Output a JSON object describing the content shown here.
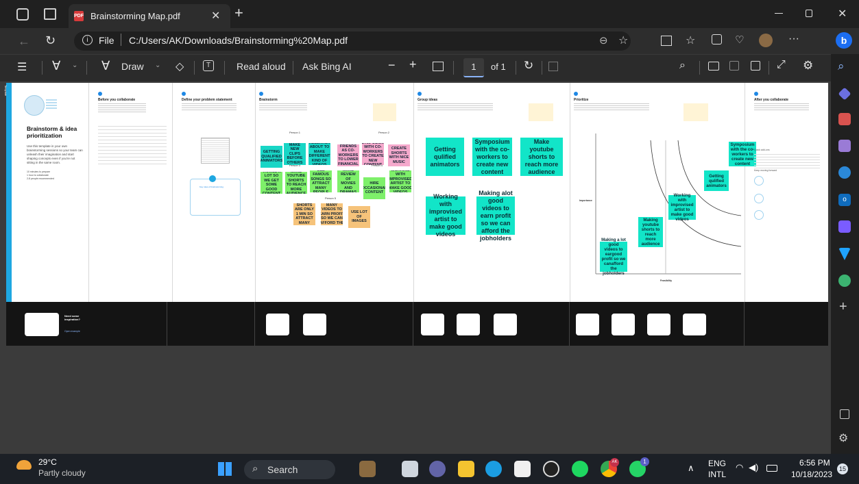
{
  "browser": {
    "tab_title": "Brainstorming Map.pdf",
    "pdf_badge": "PDF",
    "address_prefix": "File",
    "url": "C:/Users/AK/Downloads/Brainstorming%20Map.pdf"
  },
  "toolbar": {
    "draw_label": "Draw",
    "read_aloud_label": "Read aloud",
    "ask_bing_label": "Ask Bing AI",
    "page_current": "1",
    "page_total_label": "of 1"
  },
  "document": {
    "template_tab": "Template",
    "frame1": {
      "title": "Brainstorm & idea prioritization",
      "body": "Use this template in your own brainstorming sessions so your team can unleash their imagination and start shaping concepts even if you're not sitting in the same room.",
      "meta": [
        "10 minutes to prepare",
        "1 hour to collaborate",
        "2-8 people recommended"
      ]
    },
    "frame2": {
      "title": "Before you collaborate"
    },
    "frame3": {
      "title": "Define your problem statement",
      "ring_title": "Key rules of brainstorming"
    },
    "frame4": {
      "title": "Brainstorm",
      "person_labels": [
        "Person 1",
        "Person 2",
        "Person 3",
        "Person 4",
        "Person 5"
      ],
      "stickies": [
        {
          "text": "GETTING QUALIFIED ANIMATORS",
          "color": "#18d6c6"
        },
        {
          "text": "MAKE NEW CLIPS BEFORE OTHERS",
          "color": "#18d6c6"
        },
        {
          "text": "RESEARCH ABOUT TO MAKE DIFFERENT KIND OF VIDEOS",
          "color": "#18d6c6"
        },
        {
          "text": "TRAVEL A LOT SO WE GET SOME GOOD CONTENT",
          "color": "#7ef06a"
        },
        {
          "text": "MAKE YOUTUBE SHORTS TO REACH MORE AUDIENCE",
          "color": "#7ef06a"
        },
        {
          "text": "USE FAMOUS SONGS SO ATTRACT MANY PEOPLE",
          "color": "#7ef06a"
        },
        {
          "text": "MAKE OUR FRIENDS AS CO-WORKERS TO LOWER FINANCIAL NEED",
          "color": "#f5a9cc"
        },
        {
          "text": "SYMPOSIUM WITH CO-WORKERS TO CREATE NEW CONTENT",
          "color": "#f5a9cc"
        },
        {
          "text": "CREATE SHORTS WITH NICE MUSIC",
          "color": "#f5a9cc"
        },
        {
          "text": "MAKE REVIEW OF MOVIES AND DRAMAS",
          "color": "#7ef06a"
        },
        {
          "text": "HIRE OCCASIONAL CONTENT",
          "color": "#7ef06a"
        },
        {
          "text": "WORKING WITH IMPROVISED ARTIST TO MAKE GOOD VIDEOS",
          "color": "#7ef06a"
        },
        {
          "text": "YOUTUBE SHORTS ARE ONLY 1 MIN SO ATTRACT MANY PEOPLE",
          "color": "#f6c37a"
        },
        {
          "text": "MAKE LOT MANY VIDEOS TO EARN PROFIT SO WE CAN AFFORD THE JOBHOLDERS",
          "color": "#f6c37a"
        },
        {
          "text": "USE LOT OF IMAGES",
          "color": "#f6c37a"
        }
      ]
    },
    "frame5": {
      "title": "Group ideas",
      "groups": [
        "Getting qulified animators",
        "Symposium with the co-workers to create new content",
        "Make youtube shorts to reach more audience",
        "Working with improvised artist to make good videos",
        "Making alot good videos to earn profit so we can afford the jobholders"
      ]
    },
    "frame6": {
      "title": "Prioritize",
      "ylabel": "Importance",
      "xlabel": "Feasibility",
      "items": [
        "Symposium with the co-workers to create new content",
        "Getting qulified animators",
        "Working with improvised artist to make good videos",
        "Making youtube shorts to reach more audience",
        "Making a lot good videos to eargood profit so we canafford the jobholders"
      ]
    },
    "frame7": {
      "title": "After you collaborate",
      "section1": "Quick add-ons",
      "section2": "Keep moving forward"
    }
  },
  "thumbnails": {
    "frame1_label": "Need some inspiration?",
    "frame1_button": "Open example"
  },
  "taskbar": {
    "weather_temp": "29°C",
    "weather_desc": "Partly cloudy",
    "search_label": "Search",
    "lang_top": "ENG",
    "lang_bottom": "INTL",
    "time": "6:56 PM",
    "date": "10/18/2023",
    "notif_count": "15",
    "whatsapp_badge": "1",
    "avatar_initials": "AK"
  },
  "colors": {
    "teal": "#12e5c8",
    "green": "#7ef06a",
    "pink": "#f5a9cc",
    "orange": "#f6c37a",
    "accent": "#8ab4f8"
  }
}
